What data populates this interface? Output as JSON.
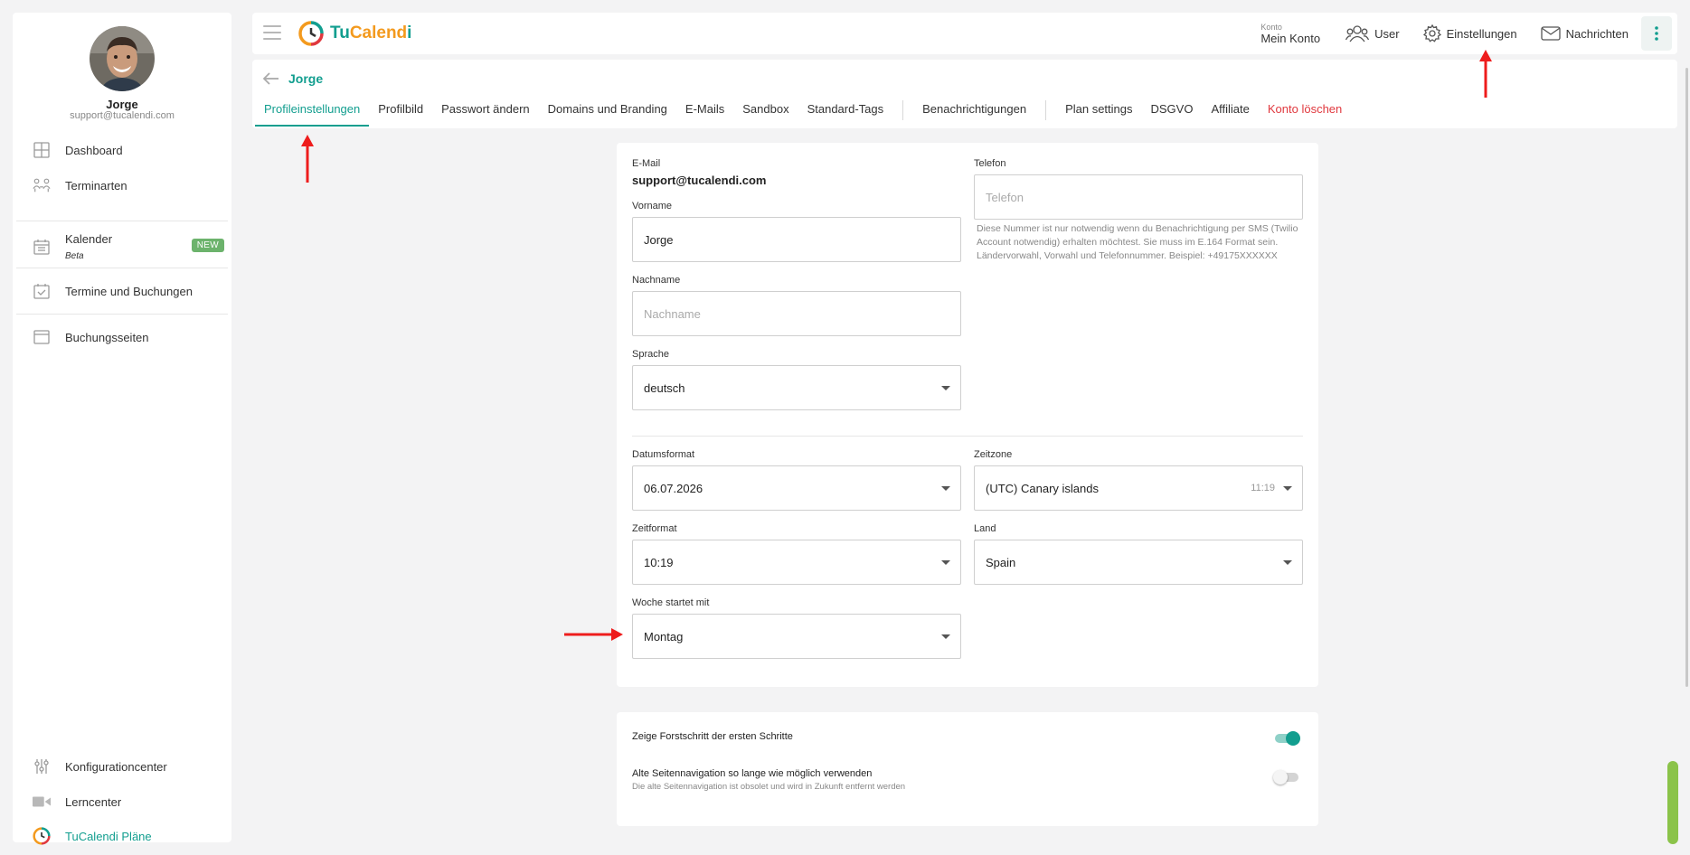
{
  "app": {
    "logo_part1": "TuCalendi",
    "logo_part1_a": "Tu",
    "logo_part1_b": "Calend",
    "logo_part1_c": "i"
  },
  "colors": {
    "accent": "#129e8f",
    "danger": "#e0383e",
    "badge": "#6cb36c",
    "annotation": "#ee1c1c",
    "logo_orange": "#f39a1e"
  },
  "sidebar": {
    "user_name": "Jorge",
    "user_email": "support@tucalendi.com",
    "items": [
      {
        "label": "Dashboard",
        "icon": "dashboard-grid-icon"
      },
      {
        "label": "Terminarten",
        "icon": "people-icon"
      },
      {
        "label": "Kalender",
        "icon": "calendar-icon",
        "badge": "NEW",
        "sub": "Beta"
      },
      {
        "label": "Termine und Buchungen",
        "icon": "calendar-check-icon"
      },
      {
        "label": "Buchungsseiten",
        "icon": "browser-window-icon"
      }
    ],
    "bottom_items": [
      {
        "label": "Konfigurationcenter",
        "icon": "sliders-icon"
      },
      {
        "label": "Lerncenter",
        "icon": "video-camera-icon"
      },
      {
        "label": "TuCalendi Pläne",
        "icon": "tucalendi-logo-icon"
      }
    ]
  },
  "header": {
    "konto_small": "Konto",
    "konto_main": "Mein Konto",
    "user_label": "User",
    "settings_label": "Einstellungen",
    "messages_label": "Nachrichten"
  },
  "page": {
    "title": "Jorge",
    "tabs": [
      "Profileinstellungen",
      "Profilbild",
      "Passwort ändern",
      "Domains und Branding",
      "E-Mails",
      "Sandbox",
      "Standard-Tags",
      "Benachrichtigungen",
      "Plan settings",
      "DSGVO",
      "Affiliate",
      "Konto löschen"
    ]
  },
  "form": {
    "email_label": "E-Mail",
    "email_value": "support@tucalendi.com",
    "phone_label": "Telefon",
    "phone_placeholder": "Telefon",
    "phone_help": "Diese Nummer ist nur notwendig wenn du Benachrichtigung per SMS (Twilio Account notwendig) erhalten möchtest. Sie muss im E.164 Format sein. Ländervorwahl, Vorwahl und Telefonnummer. Beispiel: +49175XXXXXX",
    "firstname_label": "Vorname",
    "firstname_value": "Jorge",
    "lastname_label": "Nachname",
    "lastname_placeholder": "Nachname",
    "language_label": "Sprache",
    "language_value": "deutsch",
    "dateformat_label": "Datumsformat",
    "dateformat_value": "06.07.2026",
    "timezone_label": "Zeitzone",
    "timezone_value": "(UTC) Canary islands",
    "timezone_time": "11:19",
    "timeformat_label": "Zeitformat",
    "timeformat_value": "10:19",
    "country_label": "Land",
    "country_value": "Spain",
    "weekstart_label": "Woche startet mit",
    "weekstart_value": "Montag"
  },
  "toggles": {
    "progress_label": "Zeige Forstschritt der ersten Schritte",
    "progress_on": true,
    "oldnav_label": "Alte Seitennavigation so lange wie möglich verwenden",
    "oldnav_sub": "Die alte Seitennavigation ist obsolet und wird in Zukunft entfernt werden",
    "oldnav_on": false
  }
}
